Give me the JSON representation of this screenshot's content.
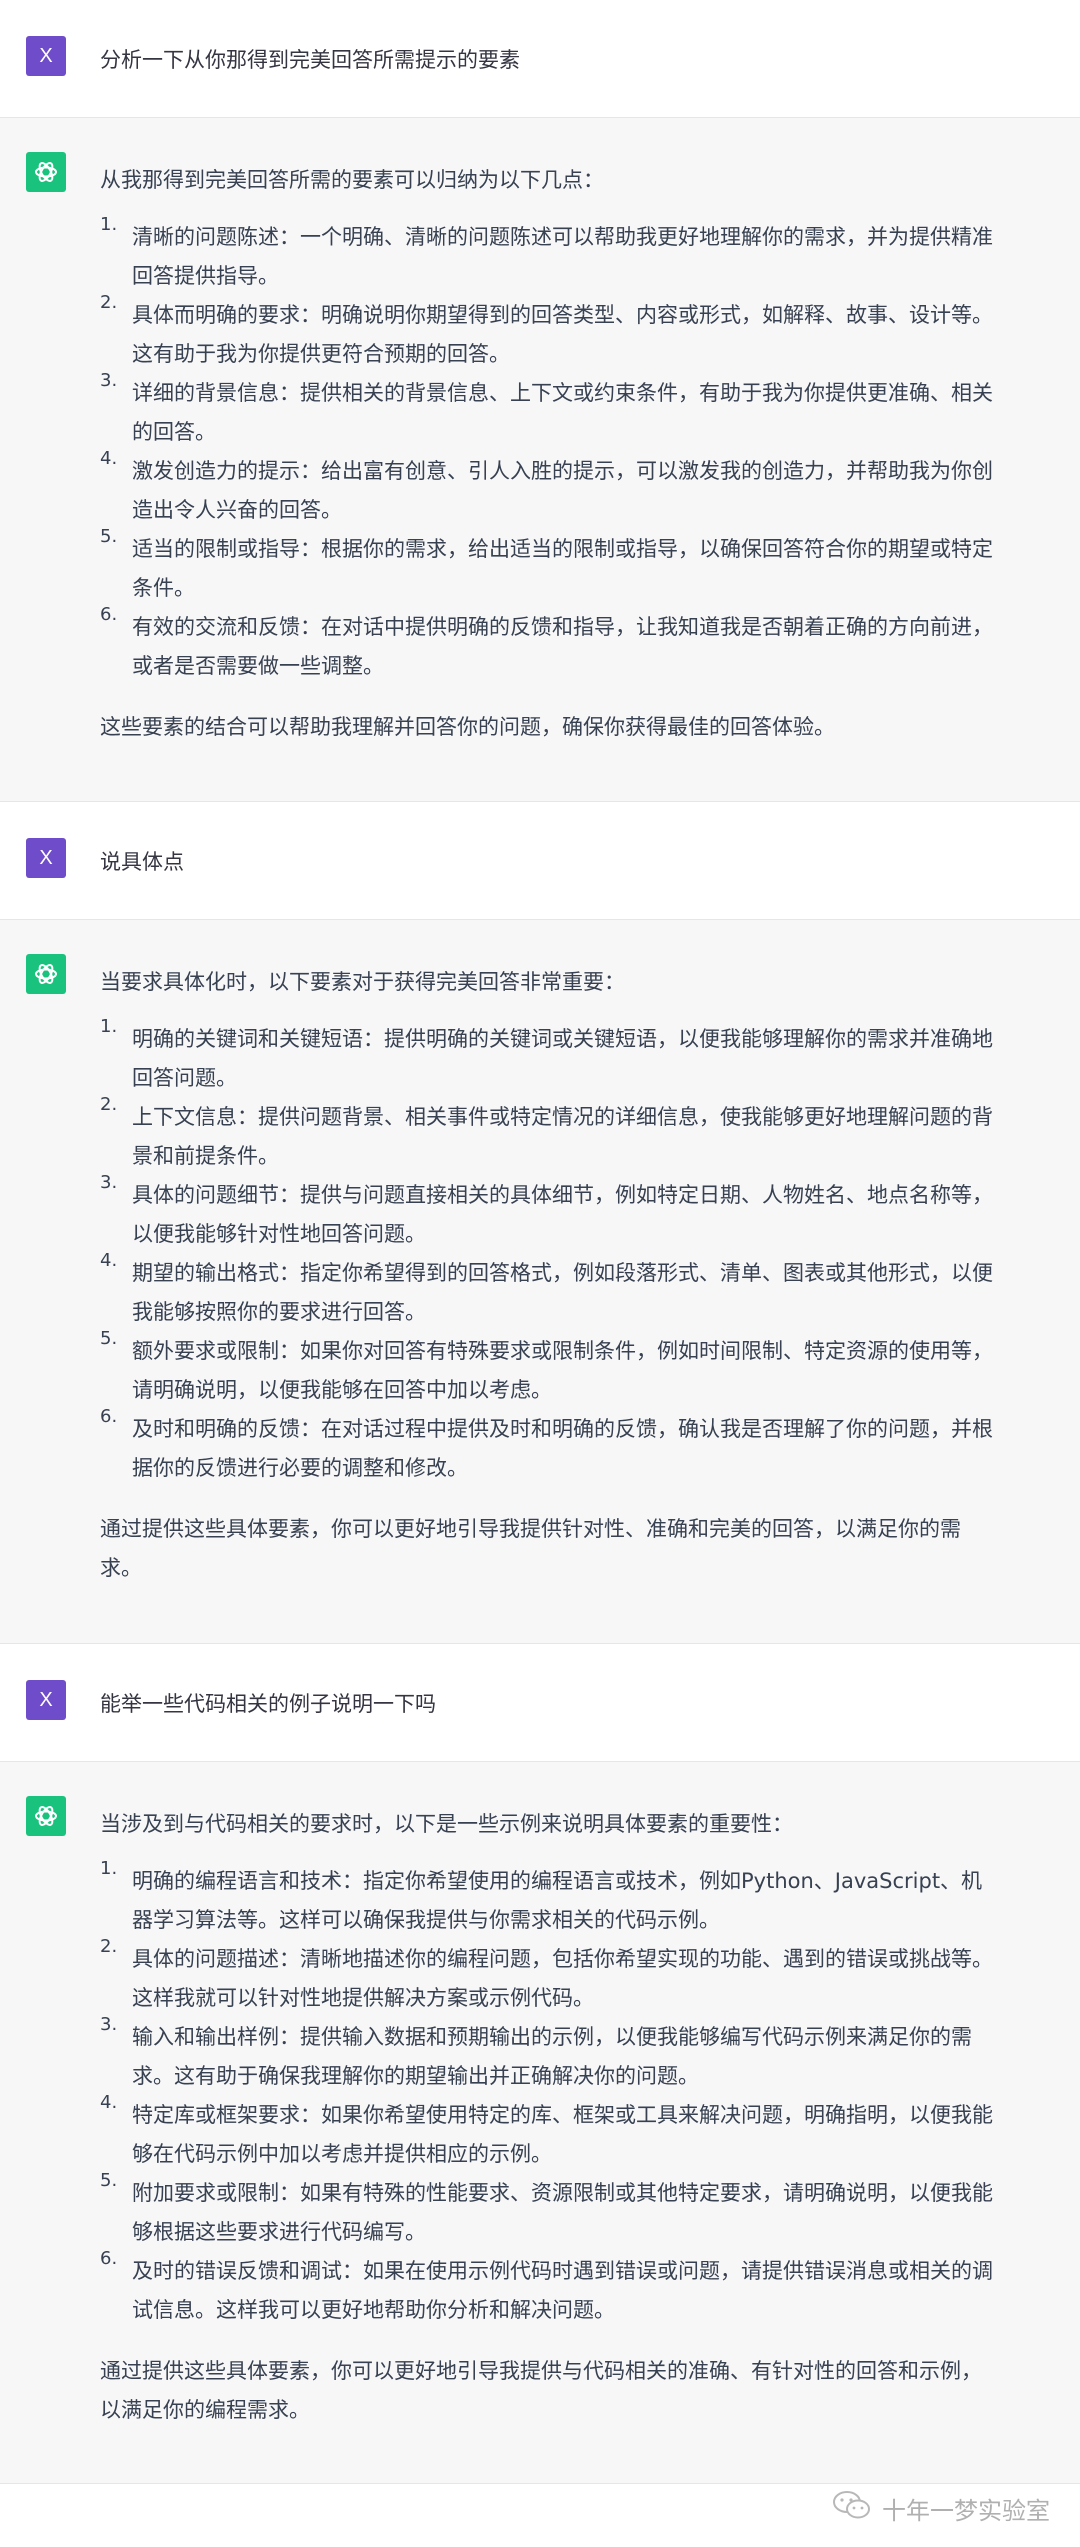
{
  "user_avatar_letter": "X",
  "conversation": [
    {
      "role": "user",
      "text": "分析一下从你那得到完美回答所需提示的要素"
    },
    {
      "role": "assistant",
      "intro": "从我那得到完美回答所需的要素可以归纳为以下几点：",
      "items": [
        {
          "num": "1.",
          "text": "清晰的问题陈述：一个明确、清晰的问题陈述可以帮助我更好地理解你的需求，并为提供精准回答提供指导。"
        },
        {
          "num": "2.",
          "text": "具体而明确的要求：明确说明你期望得到的回答类型、内容或形式，如解释、故事、设计等。这有助于我为你提供更符合预期的回答。"
        },
        {
          "num": "3.",
          "text": "详细的背景信息：提供相关的背景信息、上下文或约束条件，有助于我为你提供更准确、相关的回答。"
        },
        {
          "num": "4.",
          "text": "激发创造力的提示：给出富有创意、引人入胜的提示，可以激发我的创造力，并帮助我为你创造出令人兴奋的回答。"
        },
        {
          "num": "5.",
          "text": "适当的限制或指导：根据你的需求，给出适当的限制或指导，以确保回答符合你的期望或特定条件。"
        },
        {
          "num": "6.",
          "text": "有效的交流和反馈：在对话中提供明确的反馈和指导，让我知道我是否朝着正确的方向前进，或者是否需要做一些调整。"
        }
      ],
      "outro": "这些要素的结合可以帮助我理解并回答你的问题，确保你获得最佳的回答体验。"
    },
    {
      "role": "user",
      "text": "说具体点"
    },
    {
      "role": "assistant",
      "intro": "当要求具体化时，以下要素对于获得完美回答非常重要：",
      "items": [
        {
          "num": "1.",
          "text": "明确的关键词和关键短语：提供明确的关键词或关键短语，以便我能够理解你的需求并准确地回答问题。"
        },
        {
          "num": "2.",
          "text": "上下文信息：提供问题背景、相关事件或特定情况的详细信息，使我能够更好地理解问题的背景和前提条件。"
        },
        {
          "num": "3.",
          "text": "具体的问题细节：提供与问题直接相关的具体细节，例如特定日期、人物姓名、地点名称等，以便我能够针对性地回答问题。"
        },
        {
          "num": "4.",
          "text": "期望的输出格式：指定你希望得到的回答格式，例如段落形式、清单、图表或其他形式，以便我能够按照你的要求进行回答。"
        },
        {
          "num": "5.",
          "text": "额外要求或限制：如果你对回答有特殊要求或限制条件，例如时间限制、特定资源的使用等，请明确说明，以便我能够在回答中加以考虑。"
        },
        {
          "num": "6.",
          "text": "及时和明确的反馈：在对话过程中提供及时和明确的反馈，确认我是否理解了你的问题，并根据你的反馈进行必要的调整和修改。"
        }
      ],
      "outro": "通过提供这些具体要素，你可以更好地引导我提供针对性、准确和完美的回答，以满足你的需求。"
    },
    {
      "role": "user",
      "text": "能举一些代码相关的例子说明一下吗"
    },
    {
      "role": "assistant",
      "intro": "当涉及到与代码相关的要求时，以下是一些示例来说明具体要素的重要性：",
      "items": [
        {
          "num": "1.",
          "text": "明确的编程语言和技术：指定你希望使用的编程语言或技术，例如Python、JavaScript、机器学习算法等。这样可以确保我提供与你需求相关的代码示例。"
        },
        {
          "num": "2.",
          "text": "具体的问题描述：清晰地描述你的编程问题，包括你希望实现的功能、遇到的错误或挑战等。这样我就可以针对性地提供解决方案或示例代码。"
        },
        {
          "num": "3.",
          "text": "输入和输出样例：提供输入数据和预期输出的示例，以便我能够编写代码示例来满足你的需求。这有助于确保我理解你的期望输出并正确解决你的问题。"
        },
        {
          "num": "4.",
          "text": "特定库或框架要求：如果你希望使用特定的库、框架或工具来解决问题，明确指明，以便我能够在代码示例中加以考虑并提供相应的示例。"
        },
        {
          "num": "5.",
          "text": "附加要求或限制：如果有特殊的性能要求、资源限制或其他特定要求，请明确说明，以便我能够根据这些要求进行代码编写。"
        },
        {
          "num": "6.",
          "text": "及时的错误反馈和调试：如果在使用示例代码时遇到错误或问题，请提供错误消息或相关的调试信息。这样我可以更好地帮助你分析和解决问题。"
        }
      ],
      "outro": "通过提供这些具体要素，你可以更好地引导我提供与代码相关的准确、有针对性的回答和示例，以满足你的编程需求。"
    }
  ],
  "watermark": "十年一梦实验室",
  "colors": {
    "user_avatar": "#6f4cc9",
    "assistant_avatar": "#19c37d",
    "assistant_bg": "#f7f7f8"
  }
}
